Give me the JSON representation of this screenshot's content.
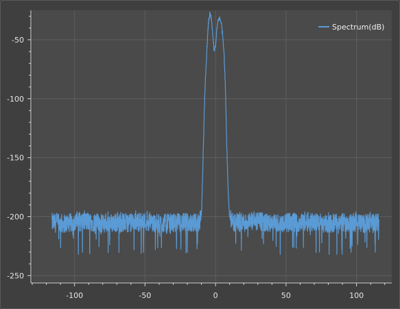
{
  "chart_data": {
    "type": "line",
    "title": "",
    "xlabel": "",
    "ylabel": "",
    "xlim": [
      -130,
      125
    ],
    "ylim": [
      -255,
      -25
    ],
    "x_ticks": [
      -100,
      -50,
      0,
      50,
      100
    ],
    "y_ticks": [
      -50,
      -100,
      -150,
      -200,
      -250
    ],
    "x_tick_labels": [
      "-100",
      "-50",
      "0",
      "50",
      "100"
    ],
    "y_tick_labels": [
      "-50",
      "-100",
      "-150",
      "-200",
      "-250"
    ],
    "grid": true,
    "legend": {
      "position": "top-right",
      "entries": [
        "Spectrum(dB)"
      ]
    },
    "series": [
      {
        "name": "Spectrum(dB)",
        "color": "#5b9bd5",
        "noise_floor_mean": -205,
        "noise_floor_range": [
          -232,
          -195
        ],
        "x_range": [
          -116,
          116
        ],
        "points": [
          [
            -116,
            -205
          ],
          [
            -110,
            -206
          ],
          [
            -100,
            -205
          ],
          [
            -90,
            -204
          ],
          [
            -80,
            -206
          ],
          [
            -70,
            -205
          ],
          [
            -60,
            -205
          ],
          [
            -50,
            -204
          ],
          [
            -40,
            -206
          ],
          [
            -30,
            -205
          ],
          [
            -20,
            -205
          ],
          [
            -12,
            -205
          ],
          [
            -10,
            -200
          ],
          [
            -9,
            -160
          ],
          [
            -8,
            -110
          ],
          [
            -7,
            -80
          ],
          [
            -6,
            -55
          ],
          [
            -5,
            -35
          ],
          [
            -4,
            -28
          ],
          [
            -3,
            -32
          ],
          [
            -2,
            -45
          ],
          [
            -1,
            -60
          ],
          [
            0,
            -55
          ],
          [
            1,
            -40
          ],
          [
            2,
            -33
          ],
          [
            3,
            -32
          ],
          [
            4,
            -35
          ],
          [
            5,
            -45
          ],
          [
            6,
            -60
          ],
          [
            7,
            -90
          ],
          [
            8,
            -140
          ],
          [
            9,
            -180
          ],
          [
            10,
            -200
          ],
          [
            12,
            -205
          ],
          [
            20,
            -205
          ],
          [
            30,
            -204
          ],
          [
            40,
            -206
          ],
          [
            50,
            -205
          ],
          [
            60,
            -205
          ],
          [
            70,
            -204
          ],
          [
            80,
            -206
          ],
          [
            90,
            -205
          ],
          [
            100,
            -205
          ],
          [
            110,
            -206
          ],
          [
            116,
            -205
          ]
        ]
      }
    ]
  },
  "colors": {
    "background": "#3f3f3f",
    "plot_area": "#4a4a4a",
    "grid": "#5e5e5e",
    "axis": "#d8d8d8",
    "text": "#e6e6e6",
    "series": "#5b9bd5"
  }
}
